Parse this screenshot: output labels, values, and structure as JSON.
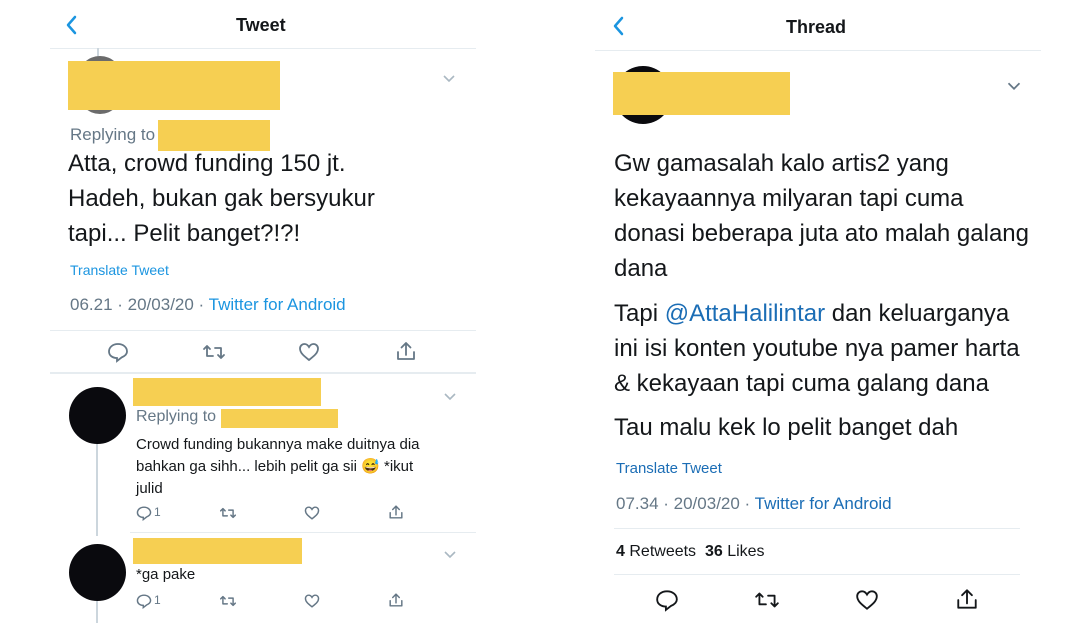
{
  "left": {
    "title": "Tweet",
    "replying_to_label": "Replying to",
    "main_text": "Atta, crowd funding 150 jt. Hadeh, bukan gak bersyukur tapi... Pelit banget?!?!",
    "translate": "Translate Tweet",
    "time": "06.21 · 20/03/20 · ",
    "source": "Twitter for Android",
    "reply1": {
      "replying_to_label": "Replying to",
      "text_line1": "Crowd funding bukannya make duitnya dia",
      "text_line2": "bahkan ga sihh... lebih pelit ga sii 😅 *ikut",
      "text_line3": "julid",
      "reply_count": "1"
    },
    "reply2": {
      "text": "*ga pake",
      "reply_count": "1"
    }
  },
  "right": {
    "title": "Thread",
    "para1": "Gw gamasalah kalo artis2 yang kekayaannya milyaran tapi cuma donasi beberapa juta ato malah galang dana",
    "para2_prefix": "Tapi ",
    "para2_mention": "@AttaHalilintar",
    "para2_rest": " dan keluarganya ini isi konten youtube nya pamer harta & kekayaan tapi cuma galang dana",
    "para3": "Tau malu kek lo pelit banget dah",
    "translate": "Translate Tweet",
    "time": "07.34 · 20/03/20 · ",
    "source": "Twitter for Android",
    "retweets_count": "4",
    "retweets_label": "Retweets",
    "likes_count": "36",
    "likes_label": "Likes"
  },
  "colors": {
    "accent": "#1b95e0",
    "redaction": "#f6cf52",
    "text": "#14171a",
    "muted": "#657786"
  }
}
